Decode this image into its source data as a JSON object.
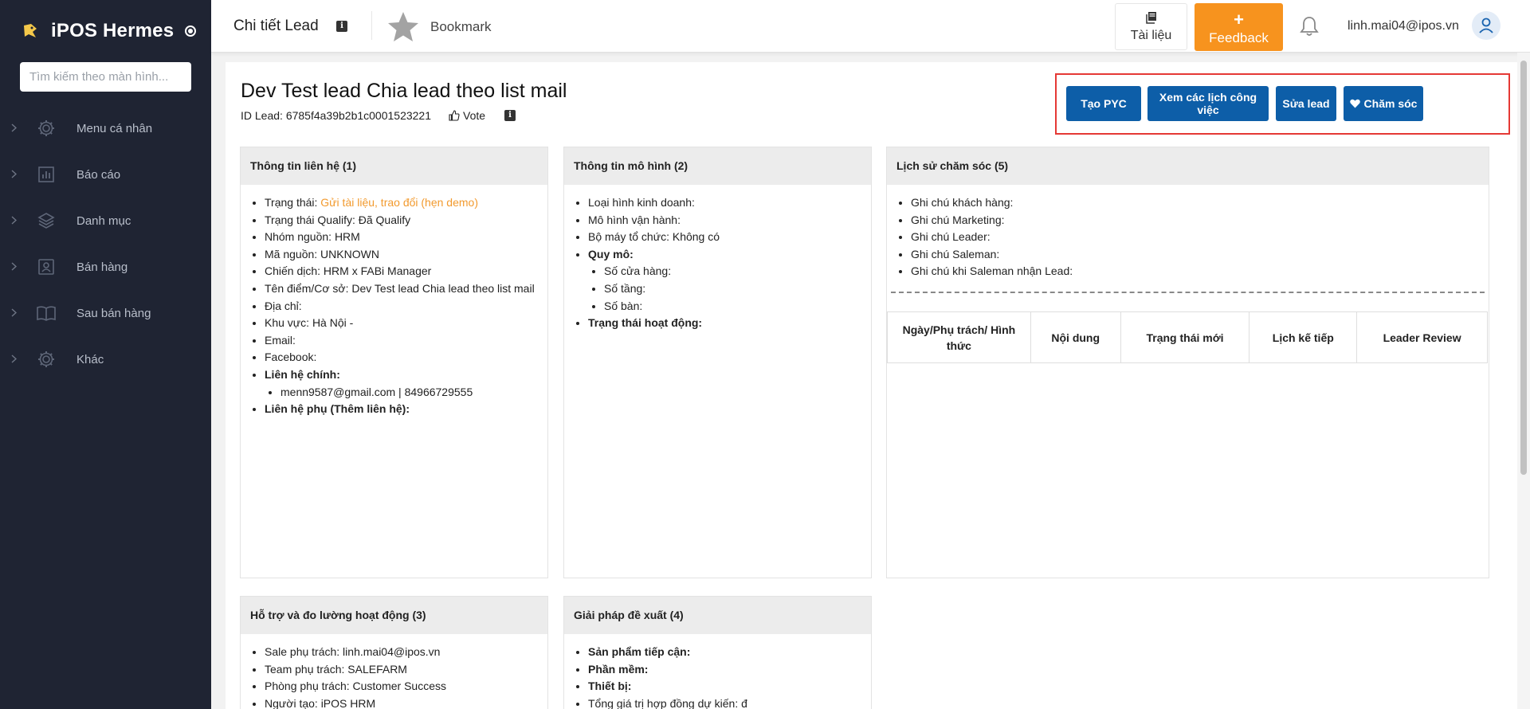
{
  "sidebar": {
    "brand": "iPOS Hermes",
    "search_placeholder": "Tìm kiếm theo màn hình...",
    "items": [
      {
        "label": "Menu cá nhân",
        "icon": "gear-icon"
      },
      {
        "label": "Báo cáo",
        "icon": "report-icon"
      },
      {
        "label": "Danh mục",
        "icon": "layers-icon"
      },
      {
        "label": "Bán hàng",
        "icon": "contact-card-icon"
      },
      {
        "label": "Sau bán hàng",
        "icon": "book-icon"
      },
      {
        "label": "Khác",
        "icon": "gear-icon"
      }
    ]
  },
  "header": {
    "title": "Chi tiết Lead",
    "bookmark_label": "Bookmark",
    "docs_label": "Tài liệu",
    "feedback_plus": "+",
    "feedback_label": "Feedback",
    "user_email": "linh.mai04@ipos.vn"
  },
  "lead": {
    "title": "Dev Test lead Chia lead theo list mail",
    "id_text": "ID Lead: 6785f4a39b2b1c0001523221",
    "vote_label": "Vote"
  },
  "actions": {
    "create_pyc": "Tạo PYC",
    "view_schedule": "Xem các lịch công việc",
    "edit_lead": "Sửa lead",
    "care": "Chăm sóc"
  },
  "contact_card": {
    "title": "Thông tin liên hệ (1)",
    "status_label": "Trạng thái: ",
    "status_value": "Gửi tài liệu, trao đổi (hẹn demo)",
    "qualify": "Trạng thái Qualify: Đã Qualify",
    "source_group": "Nhóm nguồn: HRM",
    "source_code": "Mã nguồn: UNKNOWN",
    "campaign": "Chiến dịch: HRM x FABi Manager",
    "place_name": "Tên điểm/Cơ sở: Dev Test lead Chia lead theo list mail",
    "address": "Địa chỉ:",
    "region": "Khu vực: Hà Nội -",
    "email": "Email:",
    "facebook": "Facebook:",
    "main_contact_label": "Liên hệ chính:",
    "main_contact_value": "menn9587@gmail.com | 84966729555",
    "secondary_contact_label": "Liên hệ phụ (Thêm liên hệ):"
  },
  "model_card": {
    "title": "Thông tin mô hình (2)",
    "business_type": "Loại hình kinh doanh:",
    "operation_model": "Mô hình vận hành:",
    "org_structure": "Bộ máy tổ chức: Không có",
    "scale_label": "Quy mô:",
    "stores": "Số cửa hàng:",
    "floors": "Số tầng:",
    "tables": "Số bàn:",
    "operating_status": "Trạng thái hoạt động:"
  },
  "care_card": {
    "title": "Lịch sử chăm sóc (5)",
    "notes": [
      "Ghi chú khách hàng:",
      "Ghi chú Marketing:",
      "Ghi chú Leader:",
      "Ghi chú Saleman:",
      "Ghi chú khi Saleman nhận Lead:"
    ],
    "table_headers": [
      "Ngày/Phụ trách/ Hình thức",
      "Nội dung",
      "Trạng thái mới",
      "Lịch kế tiếp",
      "Leader Review"
    ]
  },
  "support_card": {
    "title": "Hỗ trợ và đo lường hoạt động (3)",
    "sale_owner": "Sale phụ trách: linh.mai04@ipos.vn",
    "team_owner": "Team phụ trách: SALEFARM",
    "dept_owner": "Phòng phụ trách: Customer Success",
    "creator": "Người tạo: iPOS HRM"
  },
  "solution_card": {
    "title": "Giải pháp đề xuất (4)",
    "product_label": "Sản phẩm tiếp cận:",
    "software_label": "Phần mềm:",
    "device_label": "Thiết bị:",
    "total_value": "Tổng giá trị hợp đồng dự kiến: đ"
  },
  "colors": {
    "sidebar_bg": "#1f2433",
    "primary_button": "#0d5ea8",
    "feedback": "#f7931e",
    "status_orange": "#f29a2e",
    "highlight_border": "#e53935"
  }
}
